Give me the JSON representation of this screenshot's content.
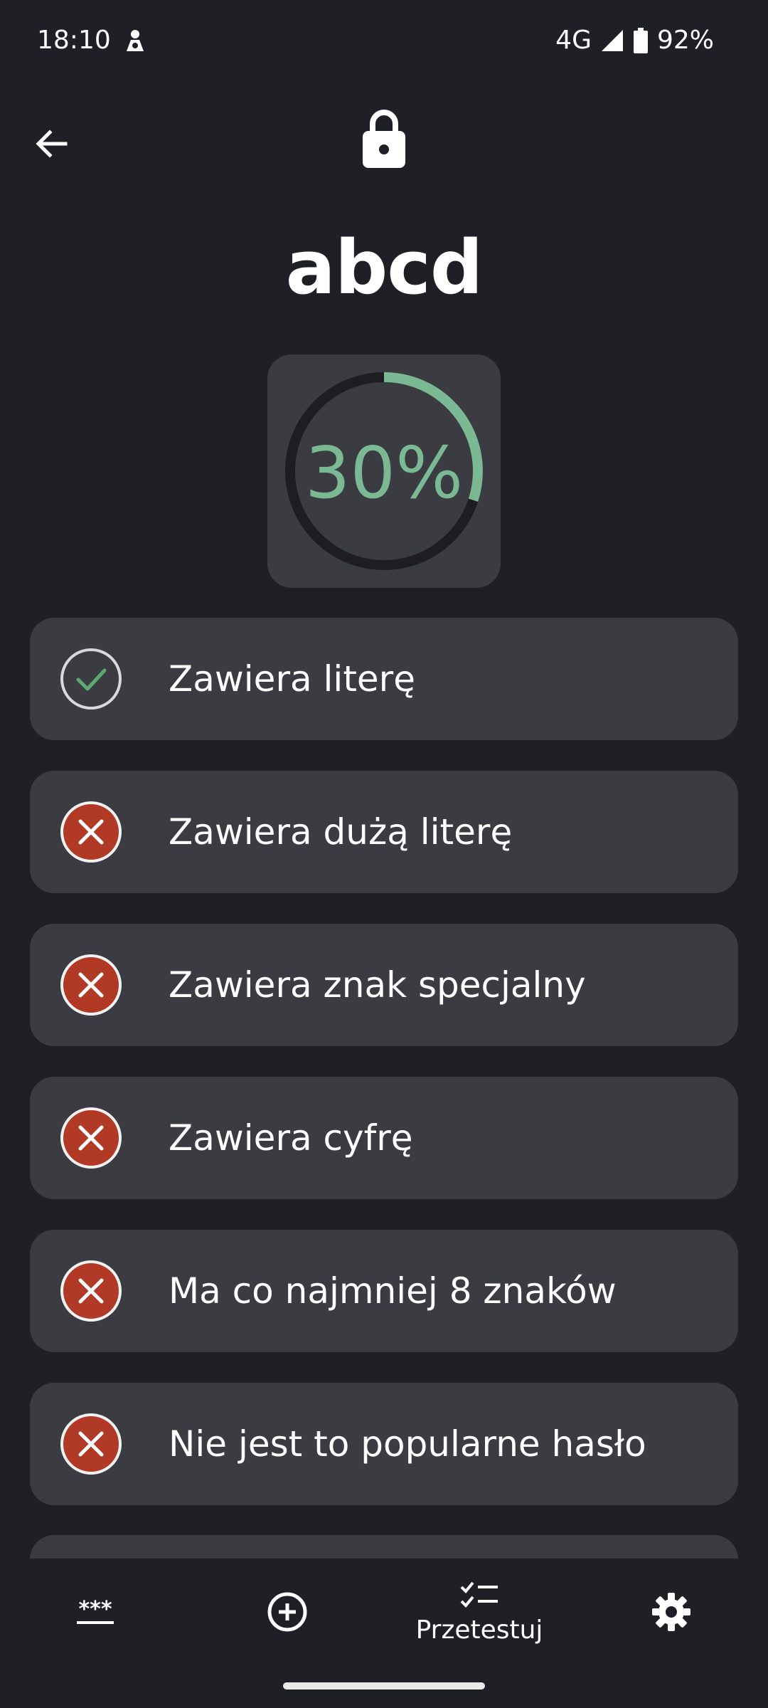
{
  "status_bar": {
    "time": "18:10",
    "network": "4G",
    "battery": "92%"
  },
  "header": {
    "back_icon": "arrow-left-icon",
    "lock_icon": "lock-icon"
  },
  "password": {
    "text": "abcd"
  },
  "strength": {
    "score_label": "30%",
    "score_fraction": 0.3,
    "accent_color": "#7bb894"
  },
  "checks": [
    {
      "label": "Zawiera literę",
      "passed": true
    },
    {
      "label": "Zawiera dużą literę",
      "passed": false
    },
    {
      "label": "Zawiera znak specjalny",
      "passed": false
    },
    {
      "label": "Zawiera cyfrę",
      "passed": false
    },
    {
      "label": "Ma co najmniej 8 znaków",
      "passed": false
    },
    {
      "label": "Nie jest to popularne hasło",
      "passed": false
    }
  ],
  "colors": {
    "pass": "#5ea874",
    "fail": "#b13a26",
    "card": "#3b3b42",
    "background": "#1f2025"
  },
  "bottom_nav": {
    "items": [
      {
        "icon": "password-dots-icon",
        "label": ""
      },
      {
        "icon": "add-circle-icon",
        "label": ""
      },
      {
        "icon": "checklist-icon",
        "label": "Przetestuj",
        "active": true
      },
      {
        "icon": "settings-gear-icon",
        "label": ""
      }
    ]
  }
}
